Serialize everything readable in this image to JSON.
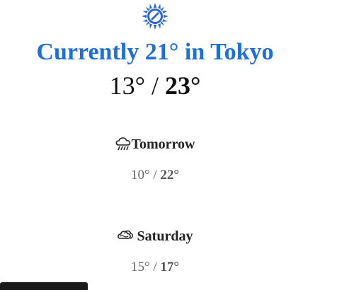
{
  "current": {
    "icon": "sun-icon",
    "prefix": "Currently ",
    "temperature": "21°",
    "middle": " in ",
    "city": "Tokyo",
    "low": "13°",
    "separator": " / ",
    "high": "23°"
  },
  "forecast": [
    {
      "icon": "rain-cloud-icon",
      "label": "Tomorrow",
      "low": "10°",
      "separator": " / ",
      "high": "22°"
    },
    {
      "icon": "cloudy-icon",
      "label": "Saturday",
      "low": "15°",
      "separator": " / ",
      "high": "17°"
    }
  ],
  "colors": {
    "title": "#1e6fd9",
    "sun": "#2a66d6",
    "bottom_bar": "#1a1a1a"
  }
}
